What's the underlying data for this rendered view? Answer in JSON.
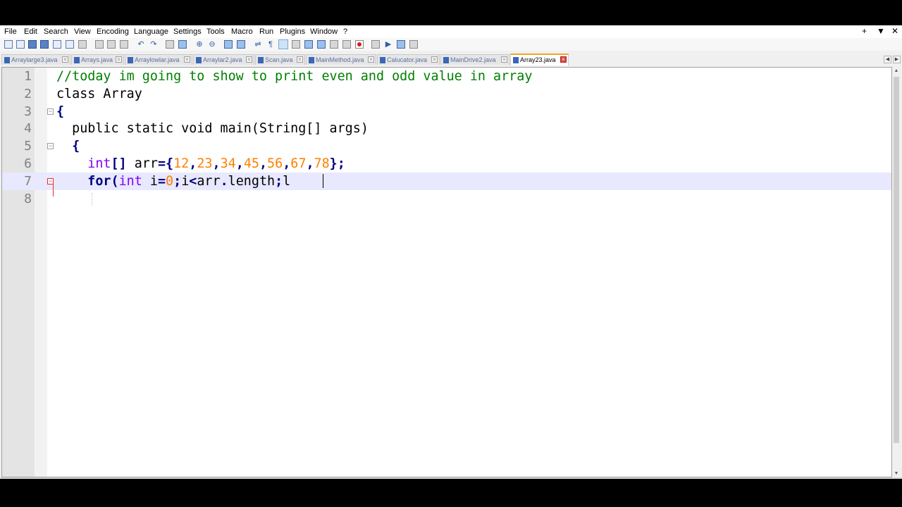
{
  "menu": {
    "items": [
      "File",
      "Edit",
      "Search",
      "View",
      "Encoding",
      "Language",
      "Settings",
      "Tools",
      "Macro",
      "Run",
      "Plugins",
      "Window",
      "?"
    ],
    "right": [
      "+",
      "▼",
      "✕"
    ]
  },
  "toolbar": {
    "icons": [
      "new-file-icon",
      "open-icon",
      "save-icon",
      "save-all-icon",
      "close-icon",
      "close-all-icon",
      "print-icon",
      "cut-icon",
      "copy-icon",
      "paste-icon",
      "undo-icon",
      "redo-icon",
      "find-icon",
      "replace-icon",
      "zoom-in-icon",
      "zoom-out-icon",
      "sync-v-icon",
      "sync-h-icon",
      "wrap-icon",
      "show-all-chars-icon",
      "indent-guide-icon",
      "udl-icon",
      "doc-map-icon",
      "function-list-icon",
      "folder-workspace-icon",
      "monitor-icon",
      "record-macro-icon",
      "stop-record-icon",
      "play-macro-icon",
      "run-macro-multiple-icon",
      "save-macro-icon"
    ]
  },
  "tabs": [
    {
      "label": "Arraylarge3.java",
      "active": false
    },
    {
      "label": "Arrays.java",
      "active": false
    },
    {
      "label": "Arraylowlar.java",
      "active": false
    },
    {
      "label": "Arraylar2.java",
      "active": false
    },
    {
      "label": "Scan.java",
      "active": false
    },
    {
      "label": "MainMethod.java",
      "active": false
    },
    {
      "label": "Calucator.java",
      "active": false
    },
    {
      "label": "MainDrive2.java",
      "active": false
    },
    {
      "label": "Array23.java",
      "active": true
    }
  ],
  "editor": {
    "current_line": 7,
    "lines": [
      {
        "n": "1",
        "tokens": [
          {
            "t": "//today im going to show to print even and odd value in array",
            "c": "comment"
          }
        ]
      },
      {
        "n": "2",
        "tokens": [
          {
            "t": "class Array",
            "c": "plain"
          }
        ]
      },
      {
        "n": "3",
        "tokens": [
          {
            "t": "{",
            "c": "op"
          }
        ]
      },
      {
        "n": "4",
        "tokens": [
          {
            "t": "  public static void ",
            "c": "plain"
          },
          {
            "t": "main(String[] args)",
            "c": "plain"
          }
        ]
      },
      {
        "n": "5",
        "tokens": [
          {
            "t": "  ",
            "c": "plain"
          },
          {
            "t": "{",
            "c": "op"
          }
        ]
      },
      {
        "n": "6",
        "tokens": [
          {
            "t": "    int",
            "c": "kw"
          },
          {
            "t": "[] ",
            "c": "op"
          },
          {
            "t": "arr",
            "c": "plain"
          },
          {
            "t": "={",
            "c": "op"
          },
          {
            "t": "12",
            "c": "num"
          },
          {
            "t": ",",
            "c": "op"
          },
          {
            "t": "23",
            "c": "num"
          },
          {
            "t": ",",
            "c": "op"
          },
          {
            "t": "34",
            "c": "num"
          },
          {
            "t": ",",
            "c": "op"
          },
          {
            "t": "45",
            "c": "num"
          },
          {
            "t": ",",
            "c": "op"
          },
          {
            "t": "56",
            "c": "num"
          },
          {
            "t": ",",
            "c": "op"
          },
          {
            "t": "67",
            "c": "num"
          },
          {
            "t": ",",
            "c": "op"
          },
          {
            "t": "78",
            "c": "num"
          },
          {
            "t": "};",
            "c": "op"
          }
        ]
      },
      {
        "n": "7",
        "tokens": [
          {
            "t": "    for",
            "c": "ctl"
          },
          {
            "t": "(",
            "c": "op"
          },
          {
            "t": "int",
            "c": "kw"
          },
          {
            "t": " i",
            "c": "plain"
          },
          {
            "t": "=",
            "c": "op"
          },
          {
            "t": "0",
            "c": "num"
          },
          {
            "t": ";",
            "c": "op"
          },
          {
            "t": "i",
            "c": "plain"
          },
          {
            "t": "<",
            "c": "op"
          },
          {
            "t": "arr",
            "c": "plain"
          },
          {
            "t": ".",
            "c": "op"
          },
          {
            "t": "length",
            "c": "plain"
          },
          {
            "t": ";",
            "c": "op"
          },
          {
            "t": "l",
            "c": "plain"
          }
        ]
      },
      {
        "n": "8",
        "tokens": [
          {
            "t": "",
            "c": "plain"
          }
        ]
      }
    ]
  }
}
